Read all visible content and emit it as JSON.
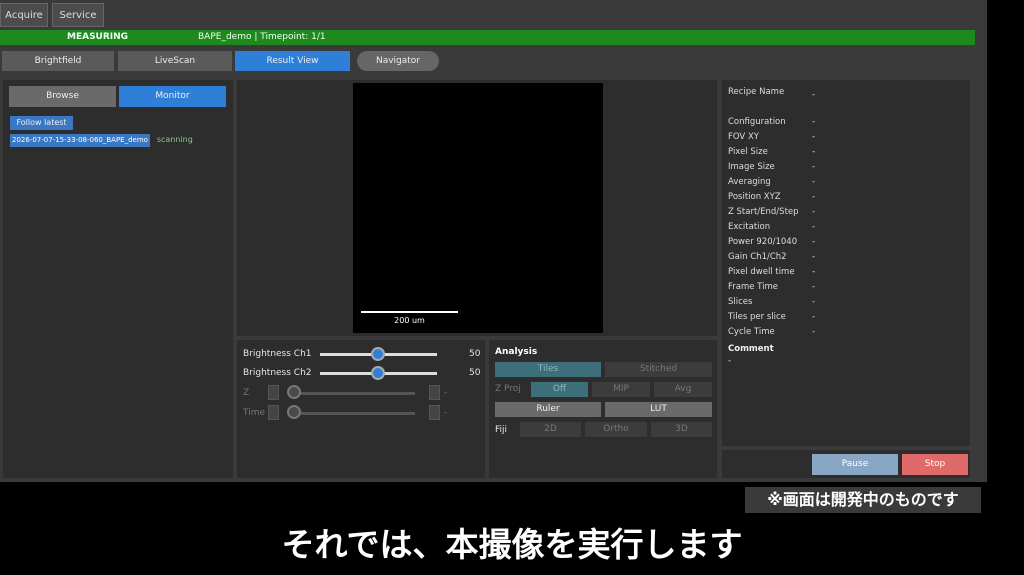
{
  "top_tabs": {
    "acquire": "Acquire",
    "service": "Service"
  },
  "status": {
    "state": "MEASURING",
    "info": "BAPE_demo | Timepoint: 1/1",
    "color": "#1e8a1e"
  },
  "view_tabs": {
    "brightfield": "Brightfield",
    "livescan": "LiveScan",
    "result_view": "Result View",
    "navigator": "Navigator"
  },
  "left": {
    "browse": "Browse",
    "monitor": "Monitor",
    "follow_latest": "Follow latest",
    "session_name": "2026-07-07-15-33-08-060_BAPE_demo",
    "session_status": "scanning"
  },
  "image": {
    "scalebar_label": "200 um"
  },
  "brightness": {
    "ch1_label": "Brightness Ch1",
    "ch1_value": "50",
    "ch2_label": "Brightness Ch2",
    "ch2_value": "50",
    "z_label": "Z",
    "z_value": "-",
    "time_label": "Time",
    "time_value": "-"
  },
  "analysis": {
    "title": "Analysis",
    "tiles": "Tiles",
    "stitched": "Stitched",
    "zproj_label": "Z Proj",
    "off": "Off",
    "mip": "MIP",
    "avg": "Avg",
    "ruler": "Ruler",
    "lut": "LUT",
    "fiji_label": "Fiji",
    "d2": "2D",
    "ortho": "Ortho",
    "d3": "3D"
  },
  "info": {
    "recipe_label": "Recipe Name",
    "recipe_value": "-",
    "rows": [
      {
        "label": "Configuration",
        "value": "-"
      },
      {
        "label": "FOV XY",
        "value": "-"
      },
      {
        "label": "Pixel Size",
        "value": "-"
      },
      {
        "label": "Image Size",
        "value": "-"
      },
      {
        "label": "Averaging",
        "value": "-"
      },
      {
        "label": "Position XYZ",
        "value": "-"
      },
      {
        "label": "Z Start/End/Step",
        "value": "-"
      },
      {
        "label": "Excitation",
        "value": "-"
      },
      {
        "label": "Power 920/1040",
        "value": "-"
      },
      {
        "label": "Gain Ch1/Ch2",
        "value": "-"
      },
      {
        "label": "Pixel dwell time",
        "value": "-"
      },
      {
        "label": "Frame Time",
        "value": "-"
      },
      {
        "label": "Slices",
        "value": "-"
      },
      {
        "label": "Tiles per slice",
        "value": "-"
      },
      {
        "label": "Cycle Time",
        "value": "-"
      }
    ],
    "comment_label": "Comment",
    "comment_value": "-"
  },
  "actions": {
    "pause": "Pause",
    "stop": "Stop"
  },
  "overlay": {
    "notice": "※画面は開発中のものです",
    "subtitle": "それでは、本撮像を実行します"
  }
}
